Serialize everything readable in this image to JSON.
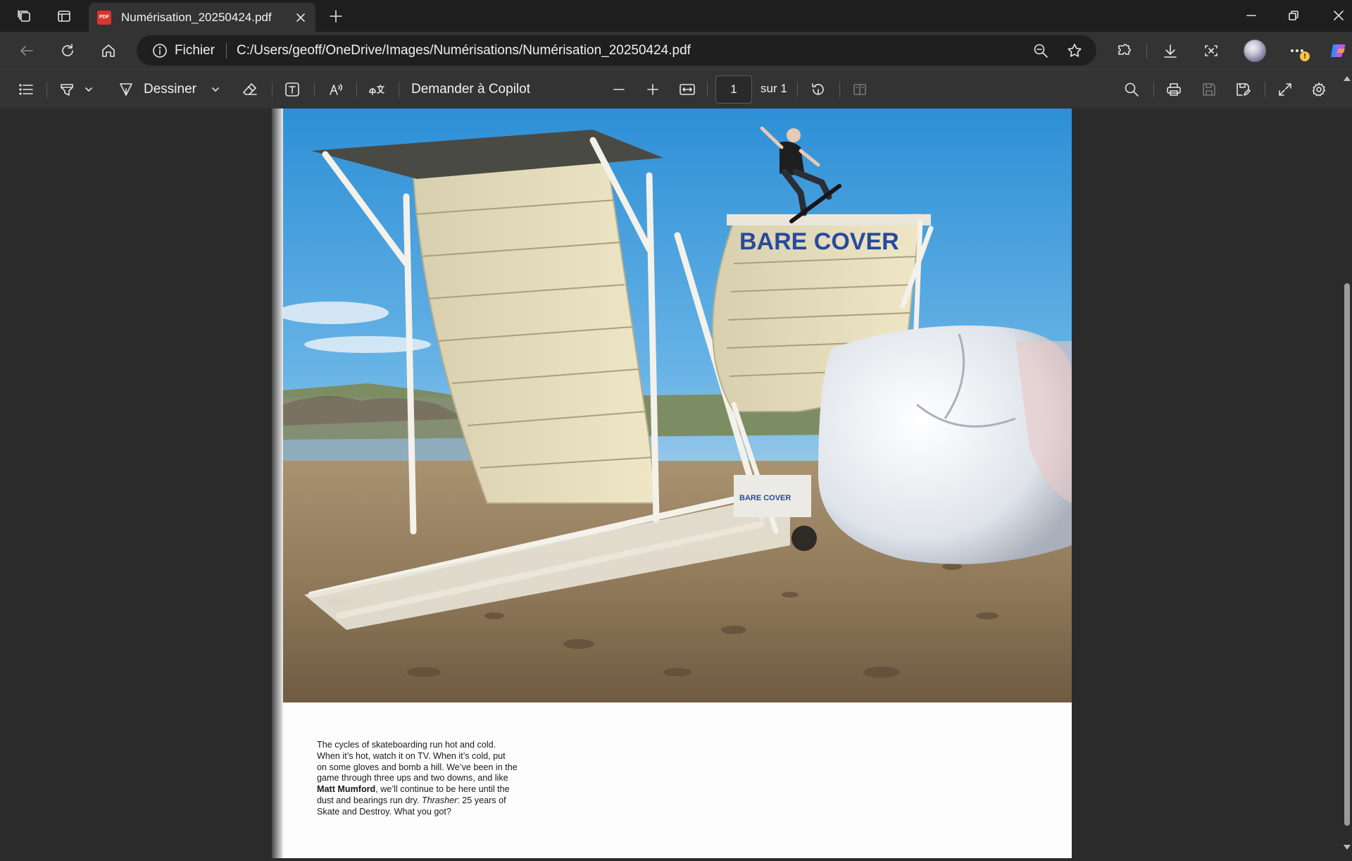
{
  "browser": {
    "tab": {
      "title": "Numérisation_20250424.pdf",
      "icon_label": "PDF"
    },
    "address": {
      "site_info_label": "Fichier",
      "url": "C:/Users/geoff/OneDrive/Images/Numérisations/Numérisation_20250424.pdf"
    },
    "notification_badge": "!"
  },
  "pdf_toolbar": {
    "draw_label": "Dessiner",
    "copilot_label": "Demander à Copilot",
    "page_current": "1",
    "page_of": "sur 1"
  },
  "document": {
    "photo_sign_text": "BARE COVER",
    "trailer_text": "BARE COVER",
    "caption": {
      "line1": "The cycles of skateboarding run hot and cold.",
      "line2": "When it’s hot, watch it on TV. When it’s cold, put",
      "line3": "on some gloves and bomb a hill. We’ve been in the",
      "line4": "game through three ups and two downs, and like",
      "name": "Matt Mumford",
      "line5_rest": ", we’ll continue to be here until the",
      "line6_start": "dust and bearings run dry. ",
      "magazine": "Thrasher",
      "line6_rest": ": 25 years of",
      "line7": "Skate and Destroy. What you got?"
    }
  }
}
